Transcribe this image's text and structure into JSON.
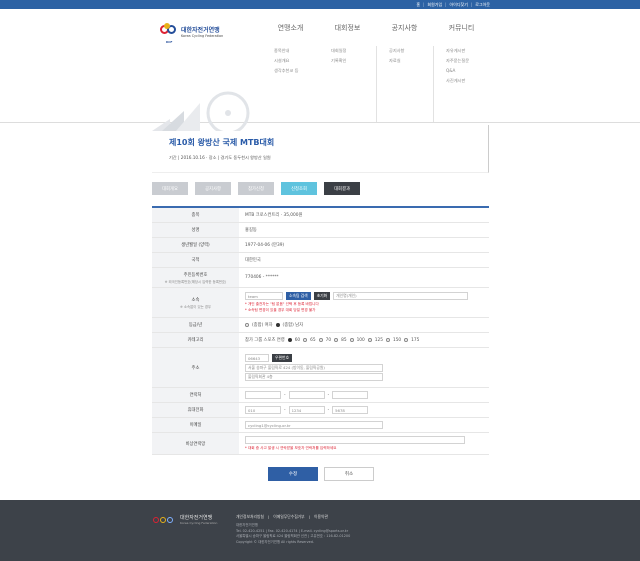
{
  "topbar": {
    "links": [
      "홈",
      "회원가입",
      "아이디찾기",
      "로그아웃"
    ]
  },
  "brand": {
    "kr": "대한자전거연맹",
    "en": "Korea Cycling Federation",
    "abbr": "KCF"
  },
  "gnb": {
    "items": [
      "연맹소개",
      "대회정보",
      "공지사항",
      "커뮤니티"
    ]
  },
  "submenu": {
    "col1": [
      "종목안내",
      "시설개요",
      "생각추천코 등"
    ],
    "col2": [
      "대회일정",
      "기록확인"
    ],
    "col3": [
      "공지사항",
      "자료실"
    ],
    "col4": [
      "자유게시판",
      "자주묻는질문",
      "Q&A",
      "사진게시판"
    ]
  },
  "event": {
    "title": "제10회 왕방산 국제 MTB대회",
    "meta": "기간 | 2016.10.16 · 장소 | 경기도 동두천시 왕방산 일원"
  },
  "tabs": [
    {
      "label": "대회개요",
      "state": "normal"
    },
    {
      "label": "공지사항",
      "state": "normal"
    },
    {
      "label": "참가신청",
      "state": "normal"
    },
    {
      "label": "신청조회",
      "state": "active"
    },
    {
      "label": "대회결과",
      "state": "dark"
    }
  ],
  "form": {
    "event_label": "종목",
    "event_value": "MTB 크로스컨트리 · 35,000원",
    "name_label": "성명",
    "name_value": "홍길동",
    "birth_label": "생년월일 (양력)",
    "birth_value": "1977-04-06 (만39)",
    "nation_label": "국적",
    "nation_value": "대한민국",
    "resident_label": "주민등록번호",
    "resident_note": "※ 외국인등록번호(해당시 입력한 등록번호)",
    "resident_value": "770406 - ******",
    "team_label": "소속",
    "team_note": "※ 소속없이 있는 경우",
    "team_input": "team",
    "team_btn1": "소속팀 검색",
    "team_btn2": "초기화",
    "team_placeholder": "개인명(개인)",
    "team_warn1": "* 개인 출전자는 \"팀 없음\" 선택 후 등록 바랍니다",
    "team_warn2": "* 소속팀 변경이 있을 경우 대회 당일 변경 불가",
    "grade_label": "등급/년",
    "grade_opt1": "(종합) 여자",
    "grade_opt2": "(종합) 남자",
    "class_label": "카테고리",
    "class_lead": "참가 그룹 스포츠 연령",
    "class_options": [
      "60",
      "65",
      "70",
      "85",
      "100",
      "125",
      "150",
      "175"
    ],
    "addr_label": "주소",
    "addr_zip": "06643",
    "addr_btn": "우편번호",
    "addr_line1": "서울 송파구 올림픽로 424 (방이동, 올림픽공원)",
    "addr_line2": "올림픽회관 4층",
    "phone_label": "연락처",
    "mobile_label": "휴대전화",
    "mobile_1": "010",
    "mobile_2": "1234",
    "mobile_3": "5678",
    "email_label": "이메일",
    "email_value": "cycling1@cycling.or.kr",
    "memo_label": "비상연락망",
    "memo_warn": "* 대회 중 사고 발생 시 연락받을 보호자 연락처를 입력하세요"
  },
  "actions": {
    "ok": "수정",
    "cancel": "취소"
  },
  "footer": {
    "kr": "대한자전거연맹",
    "en": "Korea Cycling Federation",
    "links": [
      "개인정보처리방침",
      "이메일무단수집거부",
      "이용약관"
    ],
    "info_lines": [
      "대한자전거연맹",
      "Tel. 02-420-4251 | Fax. 02-420-4174 | E-mail. cycling@sports.or.kr",
      "서울특별시 송파구 올림픽로 424 올림픽회관 신관 | 고유번호 : 116-82-01200",
      "Copyright © 대한자전거연맹 All rights Reserved."
    ]
  }
}
